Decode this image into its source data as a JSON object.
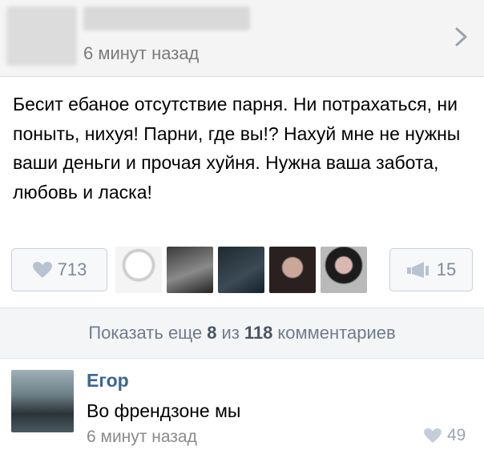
{
  "post": {
    "time": "6 минут назад",
    "text": "Бесит ебаное отсутствие парня. Ни потрахаться, ни поныть, нихуя! Парни, где вы!? Нахуй мне не нужны ваши деньги и прочая хуйня. Нужна ваша забота, любовь и ласка!",
    "likes": "713",
    "reposts": "15"
  },
  "show_more": {
    "prefix": "Показать еще",
    "shown": "8",
    "middle": "из",
    "total": "118",
    "suffix": "комментариев"
  },
  "comment": {
    "author": "Егор",
    "text": "Во френдзоне мы",
    "time": "6 минут назад",
    "likes": "49"
  },
  "colors": {
    "name": "#3c6591",
    "count": "#7d8a99",
    "muted": "#7b7b7b"
  },
  "icons": {
    "chevron": "chevron-right-icon",
    "like": "heart-icon",
    "repost": "megaphone-icon"
  }
}
